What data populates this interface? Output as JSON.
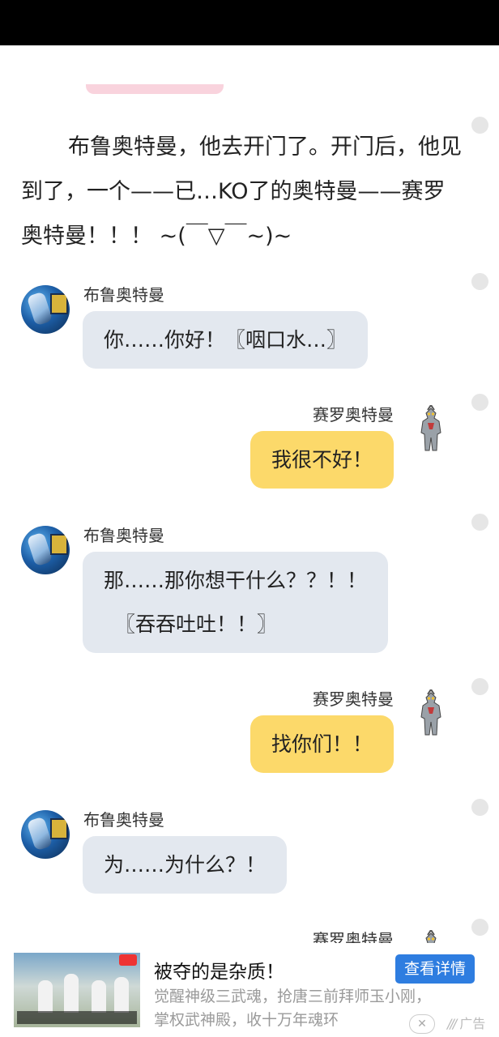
{
  "narration": "布鲁奥特曼，他去开门了。开门后，他见到了，一个——已…KO了的奥特曼——赛罗奥特曼！！！ ~(￣▽￣~)~",
  "messages": [
    {
      "side": "left",
      "name": "布鲁奥特曼",
      "text": "你……你好！〖咽口水…〗"
    },
    {
      "side": "right",
      "name": "赛罗奥特曼",
      "text": "我很不好！"
    },
    {
      "side": "left",
      "name": "布鲁奥特曼",
      "line1": "那……那你想干什么？？！！",
      "line2": "〖吞吞吐吐！！〗"
    },
    {
      "side": "right",
      "name": "赛罗奥特曼",
      "text": "找你们！！"
    },
    {
      "side": "left",
      "name": "布鲁奥特曼",
      "text": "为……为什么？！"
    },
    {
      "side": "right",
      "name": "赛罗奥特曼"
    }
  ],
  "ad": {
    "title": "被夺的是杂质！",
    "button": "查看详情",
    "desc_line1": "觉醒神级三武魂，抢唐三前拜师玉小刚，",
    "desc_line2": "掌权武神殿，收十万年魂环",
    "close_icon": "close-icon",
    "mark": "广告"
  },
  "colors": {
    "status_bar": "#000000",
    "left_bubble": "#e3e8ef",
    "right_bubble": "#fcd96a",
    "ad_button": "#2e7de0"
  }
}
